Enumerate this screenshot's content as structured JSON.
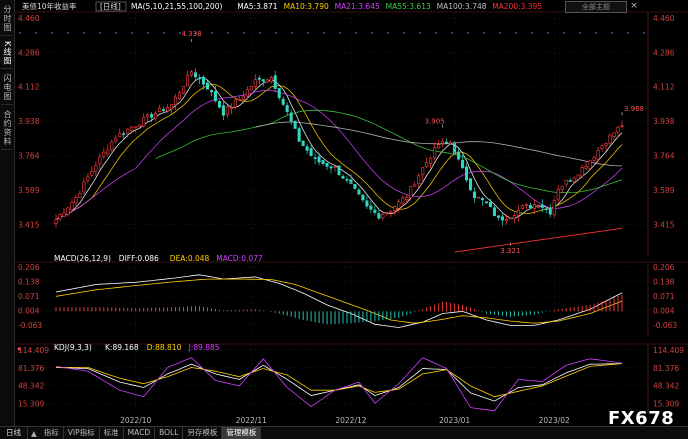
{
  "sidebar": {
    "items": [
      "分时图",
      "K线图",
      "闪电图",
      "合约资料"
    ]
  },
  "header": {
    "title": "美债10年收益率",
    "period": "日线",
    "zoom_label": "全部主题",
    "close_glyph": "×"
  },
  "bottom_bar": {
    "tabs": [
      "日线",
      "指标",
      "VIP指标",
      "标准",
      "MACD",
      "BOLL",
      "另存模板",
      "管理模板"
    ],
    "active_index": 7
  },
  "watermark": "FX678",
  "colors": {
    "up": "#ff4040",
    "down": "#33d6c0",
    "ma5": "#ffffff",
    "ma10": "#ffd000",
    "ma21": "#d040ff",
    "ma55": "#40d040",
    "ma100": "#c0c0c0",
    "ma200": "#ff3030",
    "diff": "#ffffff",
    "dea": "#ffd000",
    "k": "#ffffff",
    "d": "#ffd000",
    "j": "#d040ff"
  },
  "chart_data": [
    {
      "type": "candlestick",
      "legend": [
        {
          "label": "MA(5,10,21,55,100,200)",
          "color_key": "ma5"
        },
        {
          "label": "MA5:3.871",
          "color_key": "ma5"
        },
        {
          "label": "MA10:3.790",
          "color_key": "ma10"
        },
        {
          "label": "MA21:3.645",
          "color_key": "ma21"
        },
        {
          "label": "MA55:3.613",
          "color_key": "ma55"
        },
        {
          "label": "MA100:3.748",
          "color_key": "ma100"
        },
        {
          "label": "MA200:3.395",
          "color_key": "ma200"
        }
      ],
      "y_ticks": [
        "4.460",
        "4.286",
        "4.112",
        "3.938",
        "3.764",
        "3.589",
        "3.415"
      ],
      "ylim": [
        3.27,
        4.46
      ],
      "x_ticks": [
        {
          "index": 20,
          "label": "2022/10"
        },
        {
          "index": 49,
          "label": "2022/11"
        },
        {
          "index": 74,
          "label": "2022/12"
        },
        {
          "index": 100,
          "label": "2023/01"
        },
        {
          "index": 125,
          "label": "2023/02"
        }
      ],
      "annotations": [
        {
          "index": 34,
          "value": 4.338,
          "label": "4.338",
          "pos": "above"
        },
        {
          "index": 97,
          "value": 3.905,
          "label": "3.905",
          "pos": "left"
        },
        {
          "index": 114,
          "value": 3.321,
          "label": "3.321",
          "pos": "below"
        },
        {
          "index": 142,
          "value": 3.968,
          "label": "3.968",
          "pos": "right"
        }
      ],
      "anchors": [
        [
          0,
          3.44
        ],
        [
          5,
          3.55
        ],
        [
          10,
          3.72
        ],
        [
          15,
          3.86
        ],
        [
          20,
          3.92
        ],
        [
          25,
          3.98
        ],
        [
          29,
          4.02
        ],
        [
          34,
          4.19
        ],
        [
          38,
          4.11
        ],
        [
          42,
          3.98
        ],
        [
          46,
          4.05
        ],
        [
          50,
          4.14
        ],
        [
          54,
          4.16
        ],
        [
          58,
          3.98
        ],
        [
          61,
          3.84
        ],
        [
          65,
          3.74
        ],
        [
          70,
          3.7
        ],
        [
          74,
          3.61
        ],
        [
          78,
          3.5
        ],
        [
          81,
          3.46
        ],
        [
          84,
          3.49
        ],
        [
          88,
          3.56
        ],
        [
          92,
          3.7
        ],
        [
          96,
          3.82
        ],
        [
          99,
          3.83
        ],
        [
          102,
          3.69
        ],
        [
          105,
          3.56
        ],
        [
          108,
          3.52
        ],
        [
          111,
          3.44
        ],
        [
          114,
          3.46
        ],
        [
          117,
          3.5
        ],
        [
          121,
          3.52
        ],
        [
          124,
          3.48
        ],
        [
          126,
          3.6
        ],
        [
          130,
          3.66
        ],
        [
          134,
          3.74
        ],
        [
          138,
          3.84
        ],
        [
          142,
          3.92
        ]
      ],
      "count": 143
    },
    {
      "type": "line",
      "legend": [
        {
          "label": "MACD(26,12,9)",
          "color_key": "diff"
        },
        {
          "label": "DIFF:0.086",
          "color_key": "diff"
        },
        {
          "label": "DEA:0.048",
          "color_key": "dea"
        },
        {
          "label": "MACD:0.077",
          "color_key": "j"
        }
      ],
      "y_ticks": [
        "0.206",
        "0.138",
        "0.071",
        "0.004",
        "-0.063"
      ],
      "ylim": [
        -0.105,
        0.206
      ],
      "series": [
        {
          "name": "DIFF",
          "color_key": "diff",
          "anchors": [
            [
              0,
              0.09
            ],
            [
              10,
              0.125
            ],
            [
              20,
              0.135
            ],
            [
              30,
              0.155
            ],
            [
              36,
              0.17
            ],
            [
              42,
              0.15
            ],
            [
              50,
              0.16
            ],
            [
              56,
              0.13
            ],
            [
              62,
              0.085
            ],
            [
              68,
              0.03
            ],
            [
              74,
              -0.01
            ],
            [
              80,
              -0.06
            ],
            [
              86,
              -0.075
            ],
            [
              92,
              -0.05
            ],
            [
              97,
              -0.01
            ],
            [
              102,
              0.0
            ],
            [
              108,
              -0.04
            ],
            [
              114,
              -0.065
            ],
            [
              120,
              -0.065
            ],
            [
              126,
              -0.04
            ],
            [
              134,
              0.01
            ],
            [
              142,
              0.086
            ]
          ]
        },
        {
          "name": "DEA",
          "color_key": "dea",
          "anchors": [
            [
              0,
              0.07
            ],
            [
              10,
              0.1
            ],
            [
              20,
              0.12
            ],
            [
              30,
              0.138
            ],
            [
              38,
              0.15
            ],
            [
              46,
              0.15
            ],
            [
              54,
              0.148
            ],
            [
              60,
              0.125
            ],
            [
              66,
              0.085
            ],
            [
              72,
              0.045
            ],
            [
              78,
              0.005
            ],
            [
              84,
              -0.04
            ],
            [
              90,
              -0.055
            ],
            [
              96,
              -0.04
            ],
            [
              102,
              -0.02
            ],
            [
              108,
              -0.03
            ],
            [
              114,
              -0.045
            ],
            [
              120,
              -0.055
            ],
            [
              126,
              -0.045
            ],
            [
              134,
              -0.01
            ],
            [
              142,
              0.048
            ]
          ]
        },
        {
          "name": "MACD",
          "color_key": "j",
          "kind": "histogram",
          "anchors": [
            [
              0,
              0.02
            ],
            [
              10,
              0.02
            ],
            [
              20,
              0.015
            ],
            [
              30,
              0.02
            ],
            [
              36,
              0.025
            ],
            [
              42,
              0.005
            ],
            [
              50,
              0.01
            ],
            [
              56,
              -0.01
            ],
            [
              62,
              -0.04
            ],
            [
              68,
              -0.06
            ],
            [
              74,
              -0.055
            ],
            [
              80,
              -0.045
            ],
            [
              86,
              -0.03
            ],
            [
              92,
              0.01
            ],
            [
              97,
              0.045
            ],
            [
              102,
              0.03
            ],
            [
              108,
              -0.01
            ],
            [
              114,
              -0.025
            ],
            [
              120,
              -0.015
            ],
            [
              126,
              0.01
            ],
            [
              134,
              0.03
            ],
            [
              142,
              0.077
            ]
          ]
        }
      ]
    },
    {
      "type": "line",
      "legend": [
        {
          "label": "KDJ(9,3,3)",
          "color_key": "k"
        },
        {
          "label": "K:89.168",
          "color_key": "k"
        },
        {
          "label": "D:88.810",
          "color_key": "d"
        },
        {
          "label": "J:89.885",
          "color_key": "j"
        }
      ],
      "y_ticks": [
        "114.409",
        "81.376",
        "48.342",
        "15.309"
      ],
      "ylim": [
        -2,
        116
      ],
      "series": [
        {
          "name": "K",
          "color_key": "k",
          "anchors": [
            [
              0,
              82
            ],
            [
              8,
              80
            ],
            [
              16,
              55
            ],
            [
              22,
              45
            ],
            [
              28,
              70
            ],
            [
              34,
              88
            ],
            [
              40,
              70
            ],
            [
              46,
              60
            ],
            [
              52,
              86
            ],
            [
              58,
              60
            ],
            [
              64,
              30
            ],
            [
              70,
              40
            ],
            [
              76,
              50
            ],
            [
              80,
              30
            ],
            [
              86,
              45
            ],
            [
              92,
              80
            ],
            [
              98,
              78
            ],
            [
              104,
              35
            ],
            [
              110,
              20
            ],
            [
              116,
              45
            ],
            [
              122,
              50
            ],
            [
              128,
              72
            ],
            [
              134,
              88
            ],
            [
              142,
              89
            ]
          ]
        },
        {
          "name": "D",
          "color_key": "d",
          "anchors": [
            [
              0,
              82
            ],
            [
              8,
              82
            ],
            [
              16,
              62
            ],
            [
              22,
              52
            ],
            [
              28,
              65
            ],
            [
              34,
              82
            ],
            [
              40,
              75
            ],
            [
              46,
              65
            ],
            [
              52,
              80
            ],
            [
              58,
              68
            ],
            [
              64,
              40
            ],
            [
              70,
              40
            ],
            [
              76,
              48
            ],
            [
              80,
              36
            ],
            [
              86,
              42
            ],
            [
              92,
              70
            ],
            [
              98,
              78
            ],
            [
              104,
              48
            ],
            [
              110,
              28
            ],
            [
              116,
              38
            ],
            [
              122,
              48
            ],
            [
              128,
              66
            ],
            [
              134,
              84
            ],
            [
              142,
              89
            ]
          ]
        },
        {
          "name": "J",
          "color_key": "j",
          "anchors": [
            [
              0,
              84
            ],
            [
              8,
              75
            ],
            [
              16,
              40
            ],
            [
              22,
              28
            ],
            [
              28,
              82
            ],
            [
              34,
              100
            ],
            [
              40,
              58
            ],
            [
              46,
              48
            ],
            [
              52,
              98
            ],
            [
              58,
              45
            ],
            [
              64,
              10
            ],
            [
              70,
              40
            ],
            [
              76,
              55
            ],
            [
              80,
              16
            ],
            [
              86,
              52
            ],
            [
              92,
              100
            ],
            [
              98,
              80
            ],
            [
              104,
              8
            ],
            [
              110,
              2
            ],
            [
              116,
              60
            ],
            [
              122,
              56
            ],
            [
              128,
              86
            ],
            [
              134,
              98
            ],
            [
              142,
              90
            ]
          ]
        }
      ]
    }
  ]
}
